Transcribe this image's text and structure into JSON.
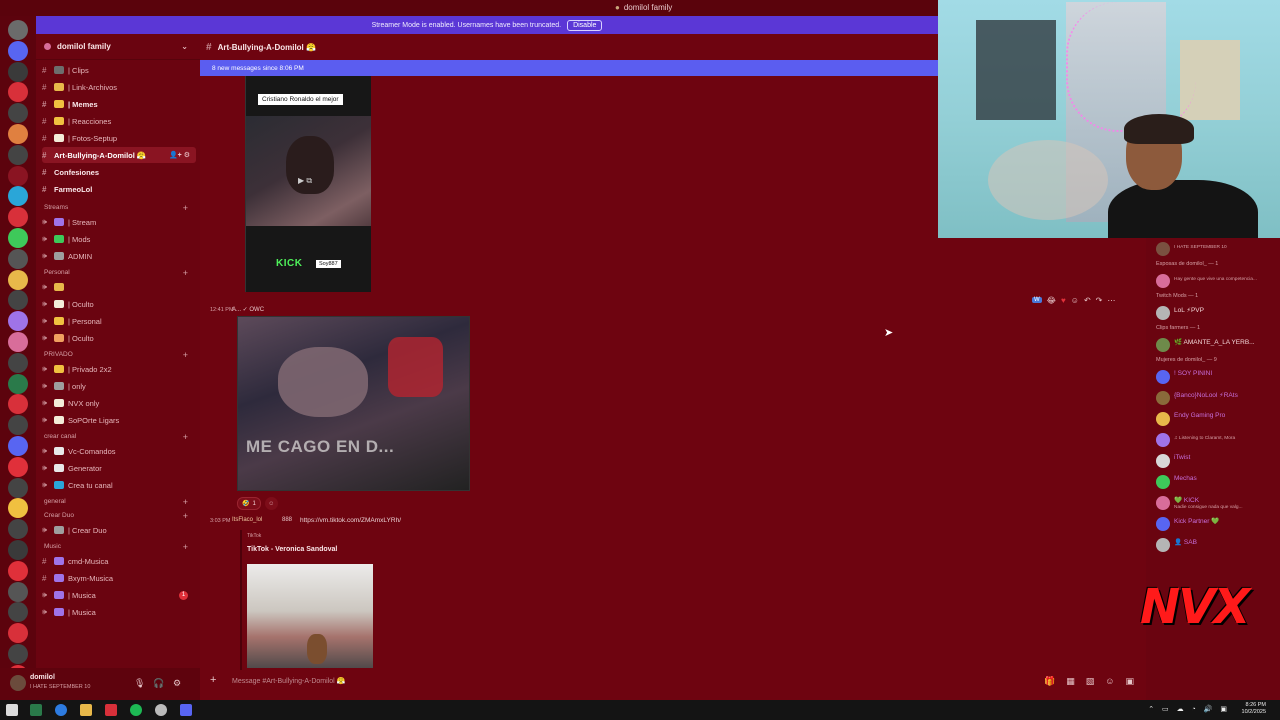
{
  "window": {
    "title": "domilol family"
  },
  "banner": {
    "text": "Streamer Mode is enabled. Usernames have been truncated.",
    "disable_label": "Disable"
  },
  "guild": {
    "name": "domilol family"
  },
  "channels": {
    "top": [
      {
        "label": "| Clips",
        "color": "#6d6d6d"
      },
      {
        "label": "| Link-Archivos",
        "color": "#e8b84a"
      },
      {
        "label": "| Memes",
        "color": "#f0c040"
      },
      {
        "label": "| Reacciones",
        "color": "#f0c040"
      },
      {
        "label": "| Fotos-Septup",
        "color": "#f3ecd8"
      },
      {
        "label": "Art-Bullying-A-Domilol 😤",
        "active": true
      },
      {
        "label": "Confesiones"
      },
      {
        "label": "FarmeoLol"
      }
    ],
    "categories": [
      {
        "name": "Streams",
        "items": [
          {
            "label": "| Stream",
            "color": "#9f73e8"
          },
          {
            "label": "| Mods",
            "color": "#3ec95a"
          },
          {
            "label": "ADMIN",
            "color": "#9e9e9e"
          }
        ]
      },
      {
        "name": "Personal",
        "items": [
          {
            "label": "",
            "color": "#e8b84a"
          },
          {
            "label": "| Oculto",
            "color": "#f3ecd8"
          },
          {
            "label": "| Personal",
            "color": "#f0c040"
          },
          {
            "label": "| Oculto",
            "color": "#f0a060"
          }
        ]
      },
      {
        "name": "PRIVADO",
        "items": [
          {
            "label": "| Privado 2x2",
            "color": "#f0c040"
          },
          {
            "label": "| only",
            "color": "#9e9e9e"
          },
          {
            "label": "NVX only",
            "color": "#f3ecd8"
          },
          {
            "label": "SoPOrte Ligars",
            "color": "#f3ecd8"
          }
        ]
      },
      {
        "name": "crear canal",
        "items": [
          {
            "label": "Vc-Comandos",
            "color": "#e8e8e8"
          },
          {
            "label": "Generator",
            "color": "#e8e8e8"
          },
          {
            "label": "Crea tu canal",
            "color": "#2aa6d8"
          }
        ]
      },
      {
        "name": "general",
        "items": []
      },
      {
        "name": "Crear Duo",
        "items": [
          {
            "label": "| Crear Duo",
            "color": "#9e9e9e"
          }
        ]
      },
      {
        "name": "Music",
        "items": [
          {
            "label": "cmd-Musica",
            "color": "#9f73e8"
          },
          {
            "label": "Bxym-Musica",
            "color": "#9f73e8"
          },
          {
            "label": "| Musica",
            "color": "#9f73e8",
            "badge": "1"
          },
          {
            "label": "| Musica",
            "color": "#9f73e8"
          }
        ]
      }
    ]
  },
  "user": {
    "name": "domilol",
    "status": "I HATE SEPTEMBER 10"
  },
  "chat": {
    "channel_name": "Art-Bullying-A-Domilol 😤",
    "new_messages": "8 new messages since 8:06 PM",
    "msg1": {
      "caption": "Cristiano Ronaldo el mejor",
      "kick": "KICK",
      "tag": "Soy887"
    },
    "msg2": {
      "time": "12:41 PM",
      "author": "A... ✓ OWC",
      "overlay_text": "ME CAGO EN D..."
    },
    "reaction": {
      "emoji": "🤣",
      "count": "1"
    },
    "msg3": {
      "time": "3:03 PM",
      "author": "ItsFlaco_lol",
      "tag": "888",
      "link": "https://vm.tiktok.com/ZMAmxLYRh/",
      "provider": "TikTok",
      "title": "TikTok - Veronica Sandoval"
    },
    "composer_placeholder": "Message #Art-Bullying-A-Domilol 😤"
  },
  "members": [
    {
      "category": "",
      "name": "",
      "status": "I HATE SEPTEMBER 10",
      "color": "#f2d6d8"
    },
    {
      "category": "Esposas de domilol_ — 1",
      "name": "",
      "status": "Hay gente que vive una competencia...",
      "color": "#d86d9a"
    },
    {
      "category": "Twitch Mods — 1",
      "name": "LoL ⚡PVP",
      "status": "",
      "color": "#f2d6d8"
    },
    {
      "category": "Clips farmers — 1",
      "name": "🌿 AMANTE_A_LA YERB...",
      "status": "",
      "color": "#f2d6d8"
    },
    {
      "category": "Mujeres de domilol_ — 9",
      "name": "! SOY PININI",
      "status": "",
      "color": "#c86fdc"
    },
    {
      "category": "",
      "name": "{Banco}NoLool ⚡RAts",
      "status": "",
      "color": "#c86fdc"
    },
    {
      "category": "",
      "name": "Endy Gaming Pro",
      "status": "",
      "color": "#c86fdc"
    },
    {
      "category": "",
      "name": "",
      "status": "♫ Listening to Claramt, Mora",
      "color": "#c86fdc"
    },
    {
      "category": "",
      "name": "iTwist",
      "status": "",
      "color": "#c86fdc"
    },
    {
      "category": "",
      "name": "Mechas",
      "status": "",
      "color": "#c86fdc"
    },
    {
      "category": "",
      "name": "💚 KICK",
      "status": "Nadie consigue nada que valg...",
      "color": "#c86fdc"
    },
    {
      "category": "",
      "name": "Kick Partner 💚",
      "status": "",
      "color": "#c86fdc"
    },
    {
      "category": "",
      "name": "👤 SAB",
      "status": "",
      "color": "#c86fdc"
    }
  ],
  "overlay": {
    "logo_text": "NVX"
  },
  "clock": {
    "time": "8:26 PM",
    "date": "10/2/2025"
  }
}
